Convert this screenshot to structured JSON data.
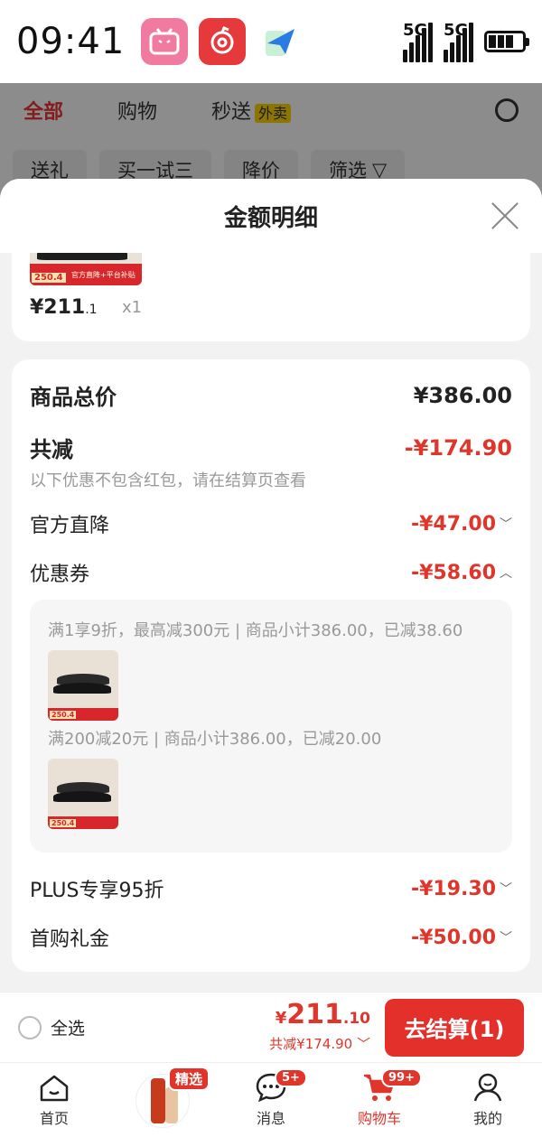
{
  "status_bar": {
    "time": "09:41",
    "network_1": "5G",
    "network_2": "5G"
  },
  "background": {
    "tabs": [
      "全部",
      "购物",
      "秒送"
    ],
    "tab_tag": "外卖",
    "chips": [
      "送礼",
      "买一试三",
      "降价",
      "筛选"
    ]
  },
  "sheet": {
    "title": "金额明细",
    "product": {
      "price_main": "¥211",
      "price_dec": ".1",
      "qty": "x1",
      "thumb_badge": "250.4",
      "thumb_desc": "官方直降+平台补贴"
    },
    "total_label": "商品总价",
    "total_value": "¥386.00",
    "reduce_label": "共减",
    "reduce_value": "-¥174.90",
    "reduce_note": "以下优惠不包含红包，请在结算页查看",
    "official_label": "官方直降",
    "official_value": "-¥47.00",
    "coupon_label": "优惠券",
    "coupon_value": "-¥58.60",
    "coupon_1": "满1享9折，最高减300元 | 商品小计386.00，已减38.60",
    "coupon_2": "满200减20元 | 商品小计386.00，已减20.00",
    "coupon_img_badge": "250.4",
    "plus_label": "PLUS专享95折",
    "plus_value": "-¥19.30",
    "gift_label": "首购礼金",
    "gift_value": "-¥50.00"
  },
  "checkout": {
    "select_all": "全选",
    "yen": "¥",
    "price_int": "211",
    "price_dec": ".10",
    "reduce_text": "共减¥174.90",
    "button": "去结算(1)"
  },
  "tabbar": {
    "home": "首页",
    "featured_tag": "精选",
    "messages": "消息",
    "messages_badge": "5+",
    "cart": "购物车",
    "cart_badge": "99+",
    "me": "我的"
  },
  "colors": {
    "accent_red": "#e0352b",
    "checkout_red": "#e4302b"
  }
}
